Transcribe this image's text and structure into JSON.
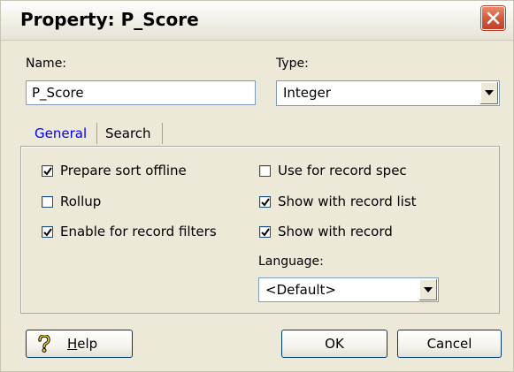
{
  "window": {
    "title": "Property:  P_Score"
  },
  "name_field": {
    "label": "Name:",
    "value": "P_Score"
  },
  "type_field": {
    "label": "Type:",
    "value": "Integer"
  },
  "tabs": [
    {
      "label": "General",
      "active": true
    },
    {
      "label": "Search",
      "active": false
    }
  ],
  "general": {
    "left_checks": [
      {
        "label": "Prepare sort offline",
        "checked": true
      },
      {
        "label": "Rollup",
        "checked": false
      },
      {
        "label": "Enable for record filters",
        "checked": true
      }
    ],
    "right_checks": [
      {
        "label": "Use for record spec",
        "checked": false
      },
      {
        "label": "Show with record list",
        "checked": true
      },
      {
        "label": "Show with record",
        "checked": true
      }
    ],
    "language_label": "Language:",
    "language_value": "<Default>"
  },
  "buttons": {
    "help_prefix": "H",
    "help_rest": "elp",
    "ok": "OK",
    "cancel": "Cancel"
  },
  "colors": {
    "active_tab": "#0000ff",
    "close_button": "#d55a3a",
    "dialog_bg": "#ece9d8"
  }
}
